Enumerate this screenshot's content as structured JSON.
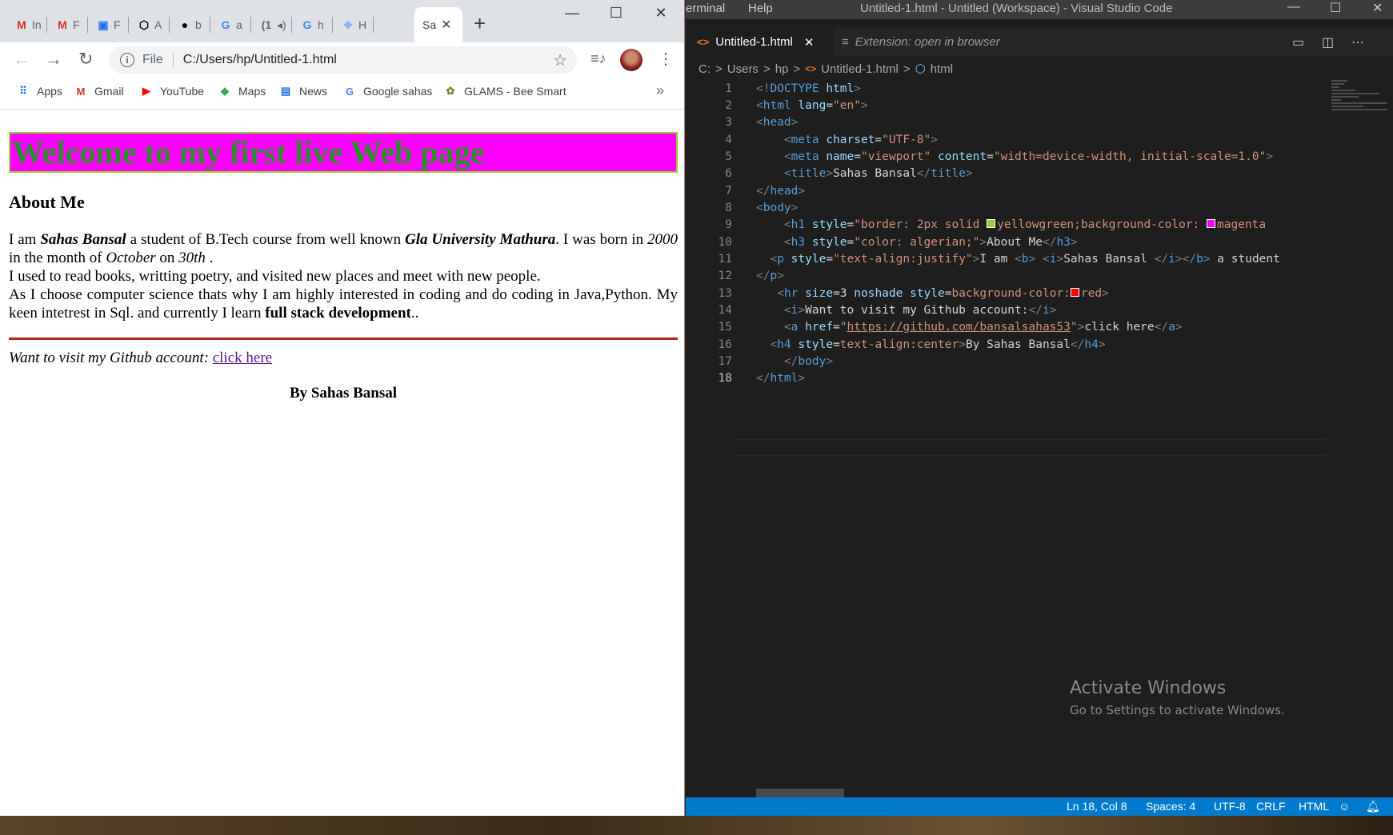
{
  "browser": {
    "tabs": [
      {
        "icon": "gmail-icon",
        "glyph": "M",
        "color": "#d93025",
        "title": "In"
      },
      {
        "icon": "gmail-icon",
        "glyph": "M",
        "color": "#d93025",
        "title": "F"
      },
      {
        "icon": "contacts-icon",
        "glyph": "▣",
        "color": "#1a73e8",
        "title": "F"
      },
      {
        "icon": "codepen-icon",
        "glyph": "⬡",
        "color": "#000000",
        "title": "A"
      },
      {
        "icon": "github-icon",
        "glyph": "●",
        "color": "#000000",
        "title": "b"
      },
      {
        "icon": "google-icon",
        "glyph": "G",
        "color": "#4285f4",
        "title": "a"
      },
      {
        "icon": "audio-icon",
        "glyph": "(1",
        "color": "#5f6368",
        "title": "◂)"
      },
      {
        "icon": "google-icon",
        "glyph": "G",
        "color": "#4285f4",
        "title": "h"
      },
      {
        "icon": "page-icon",
        "glyph": "❖",
        "color": "#8ab4f8",
        "title": "H"
      }
    ],
    "active_tab": {
      "title": "Sa",
      "close": "✕"
    },
    "new_tab": "+",
    "window_controls": {
      "minimize": "—",
      "maximize": "☐",
      "close": "✕"
    },
    "nav": {
      "back": "←",
      "forward": "→",
      "reload": "↻"
    },
    "omnibox": {
      "info": "i",
      "scheme": "File",
      "url": "C:/Users/hp/Untitled-1.html",
      "star": "☆"
    },
    "media": "≡♪",
    "menu": "⋮",
    "bookmarks": [
      {
        "icon": "apps-icon",
        "glyph": "⠿",
        "color": "#1a73e8",
        "label": "Apps"
      },
      {
        "icon": "gmail-icon",
        "glyph": "M",
        "color": "#d93025",
        "label": "Gmail"
      },
      {
        "icon": "youtube-icon",
        "glyph": "▶",
        "color": "#ff0000",
        "label": "YouTube"
      },
      {
        "icon": "maps-icon",
        "glyph": "◆",
        "color": "#34a853",
        "label": "Maps"
      },
      {
        "icon": "news-icon",
        "glyph": "▤",
        "color": "#1a73e8",
        "label": "News"
      },
      {
        "icon": "google-icon",
        "glyph": "G",
        "color": "#4285f4",
        "label": "Google sahas"
      },
      {
        "icon": "bee-icon",
        "glyph": "✿",
        "color": "#6b8e23",
        "label": "GLAMS - Bee Smart"
      }
    ],
    "bookmarks_more": "»"
  },
  "page": {
    "h1": "Welcome to my first live Web page",
    "h3": "About Me",
    "p": {
      "s1": "I am ",
      "name": "Sahas Bansal",
      "s2": " a student of B.Tech course from well known ",
      "uni": "Gla University Mathura",
      "s3": ". I was born in ",
      "year": "2000",
      "s4": " in the month of ",
      "month": "October",
      "s5": " on ",
      "day": "30th",
      "s6": " .",
      "line2": "I used to read books, writting poetry, and visited new places and meet with new people.",
      "line3": "As I choose computer science thats why I am highly interested in coding and do coding in Java,Python. My keen intetrest in Sql. and currently I learn ",
      "bold_end": "full stack development",
      "end": ".."
    },
    "git_text": "Want to visit my Github account:",
    "git_link": "click here",
    "footer": "By Sahas Bansal"
  },
  "vscode": {
    "menu": [
      "erminal",
      "Help"
    ],
    "title": "Untitled-1.html - Untitled (Workspace) - Visual Studio Code",
    "window_controls": {
      "minimize": "—",
      "maximize": "☐",
      "close": "✕"
    },
    "tab1": {
      "icon": "<>",
      "label": "Untitled-1.html",
      "close": "✕"
    },
    "tab2": {
      "icon": "≡",
      "label": "Extension: open in browser"
    },
    "breadcrumb": {
      "drive": "C:",
      "users": "Users",
      "hp": "hp",
      "file": "Untitled-1.html",
      "symbol": "html",
      "sep": ">"
    },
    "activate": {
      "title": "Activate Windows",
      "subtitle": "Go to Settings to activate Windows."
    },
    "status": {
      "position": "Ln 18, Col 8",
      "spaces": "Spaces: 4",
      "encoding": "UTF-8",
      "eol": "CRLF",
      "language": "HTML"
    },
    "colors": {
      "yellowgreen": "#9acd32",
      "magenta": "#ff00ff",
      "red": "#ff0000"
    }
  }
}
